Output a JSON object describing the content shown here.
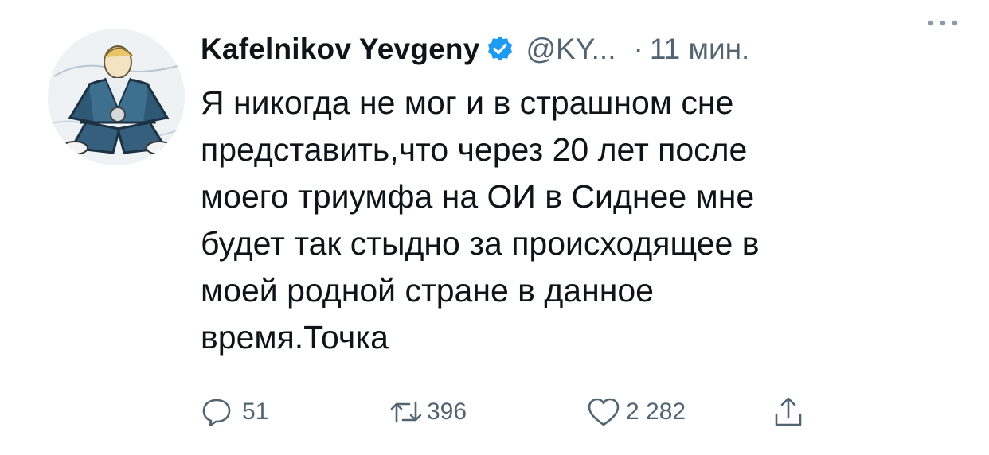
{
  "tweet": {
    "author_name": "Kafelnikov Yevgeny",
    "handle": "@KY...",
    "separator": "·",
    "time": "11 мин.",
    "text": "Я никогда не мог и в страшном сне\nпредставить,что через 20 лет после\nмоего триумфа на ОИ в Сиднее мне\nбудет так стыдно за происходящее в\nмоей родной стране в данное\nвремя.Точка",
    "replies": "51",
    "retweets": "396",
    "likes": "2 282"
  },
  "icons": {
    "verified": "verified-badge-icon",
    "more": "more-dots-icon",
    "reply": "reply-bubble-icon",
    "retweet": "retweet-icon",
    "like": "heart-icon",
    "share": "share-icon"
  },
  "colors": {
    "text": "#0f1419",
    "secondary": "#536471",
    "verified": "#1d9bf0"
  }
}
